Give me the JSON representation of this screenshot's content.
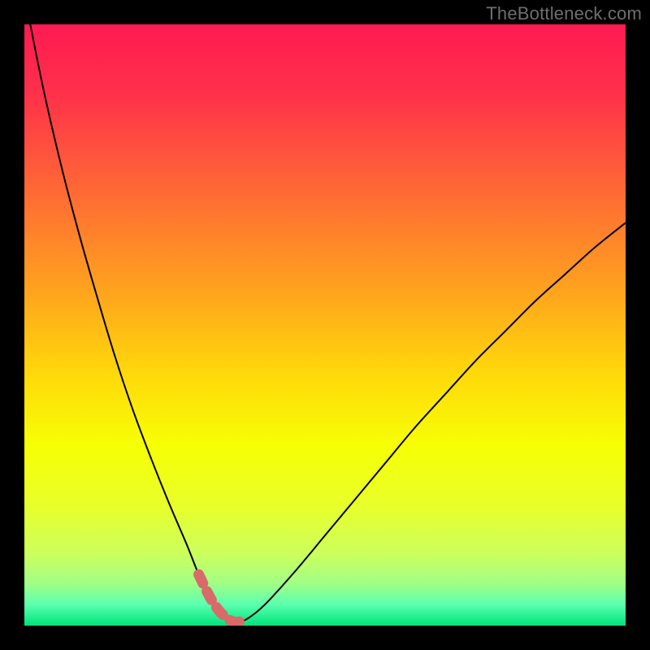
{
  "watermark": "TheBottleneck.com",
  "chart_data": {
    "type": "line",
    "title": "",
    "xlabel": "",
    "ylabel": "",
    "xlim": [
      0,
      100
    ],
    "ylim": [
      0,
      100
    ],
    "grid": false,
    "series": [
      {
        "name": "bottleneck-curve",
        "x": [
          0,
          3,
          6,
          9,
          12,
          15,
          18,
          21,
          24,
          27,
          29,
          31,
          33,
          35,
          37,
          40,
          45,
          50,
          55,
          60,
          65,
          70,
          75,
          80,
          85,
          90,
          95,
          100
        ],
        "y": [
          105,
          90,
          77,
          65.5,
          55,
          45,
          36,
          28,
          20.5,
          13.5,
          8.5,
          4.5,
          1.8,
          0.6,
          1.1,
          3.5,
          9,
          15,
          21,
          27,
          33,
          38.5,
          44,
          49,
          54,
          58.5,
          63,
          67
        ]
      }
    ],
    "optimal_band": {
      "x_range": [
        27.5,
        38.5
      ],
      "y_max": 12
    },
    "background_gradient": {
      "stops": [
        {
          "offset": 0.0,
          "color": "#ff1a52"
        },
        {
          "offset": 0.12,
          "color": "#ff324a"
        },
        {
          "offset": 0.28,
          "color": "#ff6a34"
        },
        {
          "offset": 0.44,
          "color": "#ffa21e"
        },
        {
          "offset": 0.58,
          "color": "#ffd80a"
        },
        {
          "offset": 0.7,
          "color": "#f7ff04"
        },
        {
          "offset": 0.8,
          "color": "#e8ff2a"
        },
        {
          "offset": 0.88,
          "color": "#ccff5c"
        },
        {
          "offset": 0.93,
          "color": "#a0ff86"
        },
        {
          "offset": 0.965,
          "color": "#5affb0"
        },
        {
          "offset": 1.0,
          "color": "#00e37a"
        }
      ]
    },
    "optimal_marker_color": "#d86a6a"
  }
}
